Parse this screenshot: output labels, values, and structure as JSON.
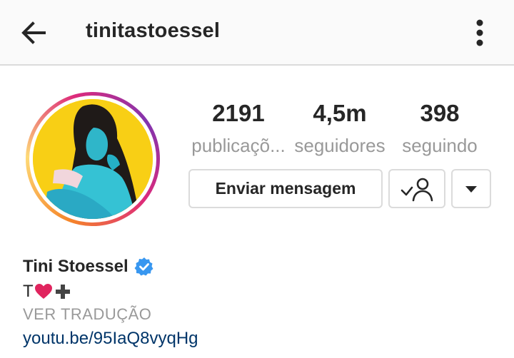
{
  "header": {
    "back_icon": "arrow-left-icon",
    "username": "tinitastoessel",
    "more_icon": "vertical-ellipsis-icon"
  },
  "profile": {
    "avatar": "profile-photo",
    "stats": [
      {
        "value": "2191",
        "label": "publicaçõ..."
      },
      {
        "value": "4,5m",
        "label": "seguidores"
      },
      {
        "value": "398",
        "label": "seguindo"
      }
    ],
    "actions": {
      "message_label": "Enviar mensagem",
      "following_icon": "following-check-person-icon",
      "dropdown_icon": "caret-down-icon"
    },
    "name": "Tini Stoessel",
    "verified_icon": "verified-badge-icon",
    "bio_text": "T",
    "bio_icons": [
      "heart-icon",
      "plus-icon"
    ],
    "translate_label": "VER TRADUÇÃO",
    "website": "youtu.be/95IaQ8vyqHg"
  },
  "colors": {
    "verified_blue": "#3897f0",
    "link_blue": "#003569",
    "muted_gray": "#999999",
    "heart_red": "#e0245e",
    "border_gray": "#dbdbdb"
  }
}
